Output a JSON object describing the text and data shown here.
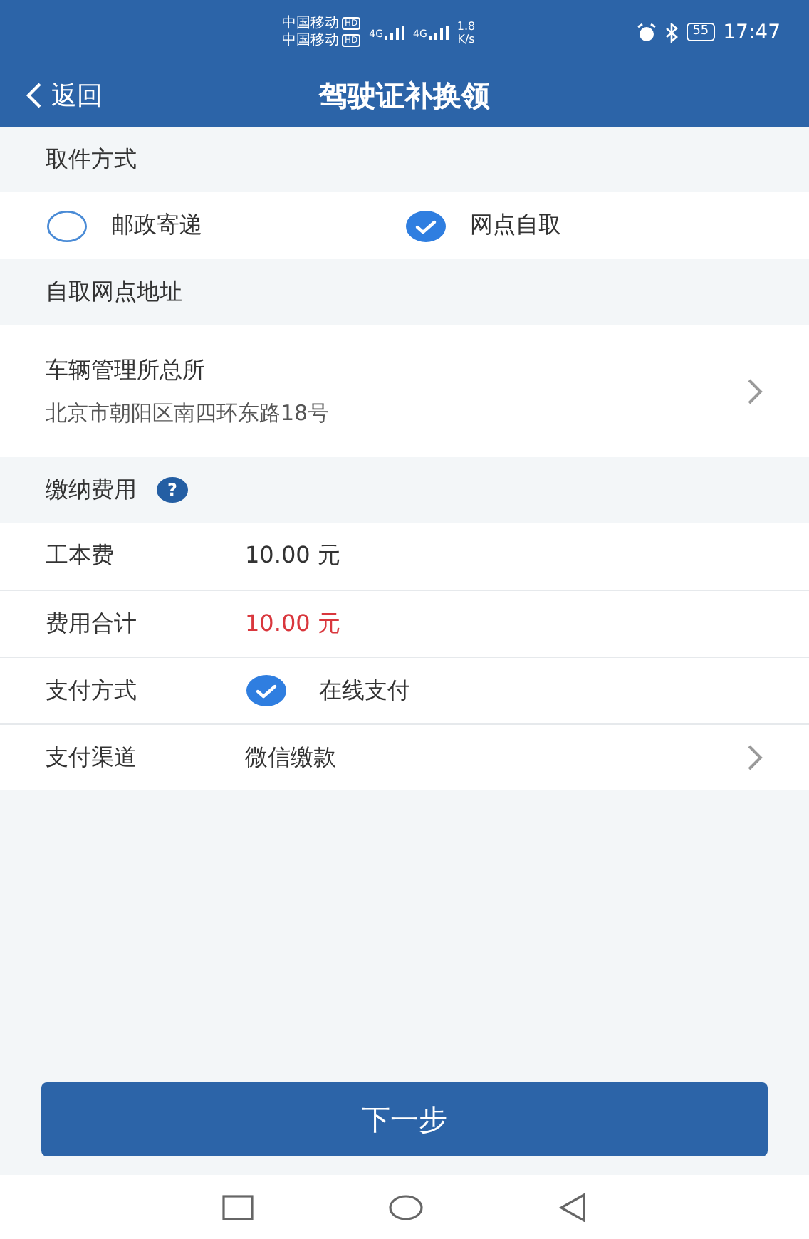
{
  "status_bar": {
    "carriers": [
      {
        "name": "中国移动",
        "badge": "HD"
      },
      {
        "name": "中国移动",
        "badge": "HD"
      }
    ],
    "network": [
      "4G",
      "4G"
    ],
    "speed": "1.8",
    "speed_unit": "K/s",
    "battery": "55",
    "time": "17:47"
  },
  "header": {
    "back": "返回",
    "title": "驾驶证补换领"
  },
  "pickup": {
    "title": "取件方式",
    "options": [
      {
        "label": "邮政寄递",
        "selected": false
      },
      {
        "label": "网点自取",
        "selected": true
      }
    ]
  },
  "address": {
    "title": "自取网点地址",
    "name": "车辆管理所总所",
    "detail": "北京市朝阳区南四环东路18号"
  },
  "fees": {
    "title": "缴纳费用",
    "help": "?",
    "rows": [
      {
        "kind": "text",
        "label": "工本费",
        "value": "10.00 元"
      },
      {
        "kind": "total",
        "label": "费用合计",
        "value": "10.00 元"
      },
      {
        "kind": "check",
        "label": "支付方式",
        "value": "在线支付",
        "checked": true
      },
      {
        "kind": "link",
        "label": "支付渠道",
        "value": "微信缴款"
      }
    ]
  },
  "next_button": "下一步"
}
